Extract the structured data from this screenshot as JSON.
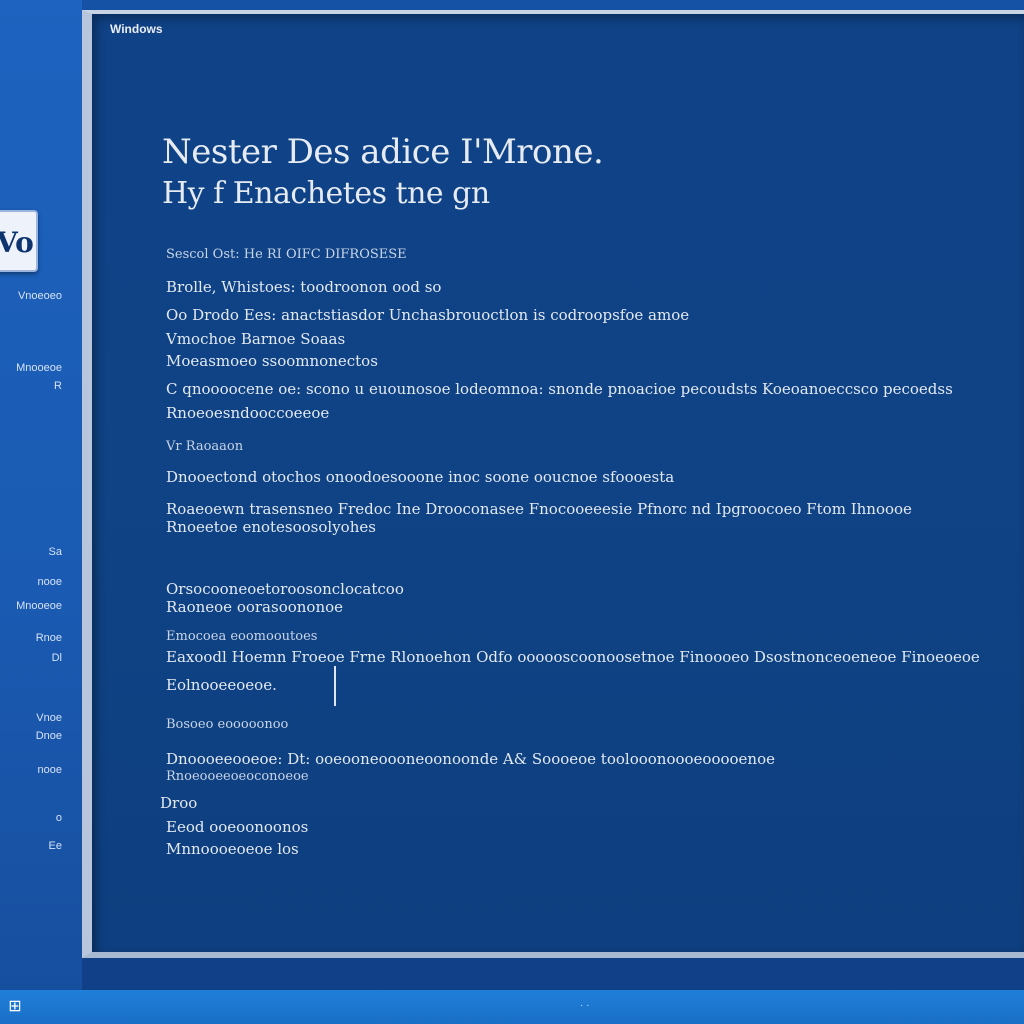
{
  "window": {
    "title": "Windows",
    "footer": ""
  },
  "heading": {
    "line1": "Nester Des adice I'Mrone.",
    "line2": "Hy f Enachetes tne gn"
  },
  "body": [
    {
      "text": "Sescol Ost: He RI OIFC DIFROSESE",
      "small": true
    },
    {
      "text": "Brolle, Whistoes: toodroonon ood so",
      "small": false
    },
    {
      "text": "Oo Drodo Ees: anactstiasdor Unchasbrouoctlon is codroopsfoe amoe",
      "small": false
    },
    {
      "text": "Vmochoe Barnoe Soaas",
      "small": false
    },
    {
      "text": "Moeasmoeo ssoomnonectos",
      "small": false
    },
    {
      "text": "C qnoooocene oe: scono u euounosoe lodeomnoa: snonde pnoacioe pecoudsts Koeoanoeccsco pecoedss",
      "small": false
    },
    {
      "text": "Rnoeoesndooccoeeoe",
      "small": false
    },
    {
      "text": "Vr Raoaaon",
      "small": true
    },
    {
      "text": "Dnooectond otochos onoodoesooone inoc soone ooucnoe sfoooesta",
      "small": false
    },
    {
      "text": "Roaeoewn trasensneo Fredoc Ine Drooconasee Fnocooeeesie Pfnorc nd Ipgroocoeo Ftom Ihnoooe",
      "small": false
    },
    {
      "text": "Rnoeetoe enotesoosolyohes",
      "small": false
    },
    {
      "text": "Orsocooneoetoroosonclocatcoo",
      "small": false
    },
    {
      "text": "Raoneoe oorasoononoe",
      "small": false
    },
    {
      "text": "Emocoea eoomooutoes",
      "small": false
    },
    {
      "text": "Eaxoodl Hoemn Froeoe Frne Rlonoehon Odfo oooooscoonoosetnoe Finoooeo Dsostnonceoeneoe Finoeoeoe",
      "small": false
    },
    {
      "text": "Eolnooeeoeoe.",
      "small": false
    },
    {
      "text": "Bosoeo eooooonoo",
      "small": true
    },
    {
      "text": "Dnoooeeooeoe: Dt: ooeooneoooneoonoonde A& Soooeoe toolooonoooeooooenoe",
      "small": false
    },
    {
      "text": "Rnoeooeeoeoconoeoe",
      "small": true
    },
    {
      "text": "Droo",
      "small": false
    },
    {
      "text": "Eeod ooeoonoonos",
      "small": false
    },
    {
      "text": "Mnnoooeoeoe los",
      "small": false
    }
  ],
  "sidebar": {
    "logo": "Vo",
    "items": [
      "Vnoeoeo",
      "Mnooeoe",
      "R",
      "Sa",
      "nooe",
      "Mnooeoe",
      "Rnoe",
      "Dl",
      "Vnoe",
      "Dnoe",
      "nooe",
      "o",
      "Ee"
    ]
  },
  "taskbar": {
    "start": "⊞",
    "label": "· ·"
  }
}
